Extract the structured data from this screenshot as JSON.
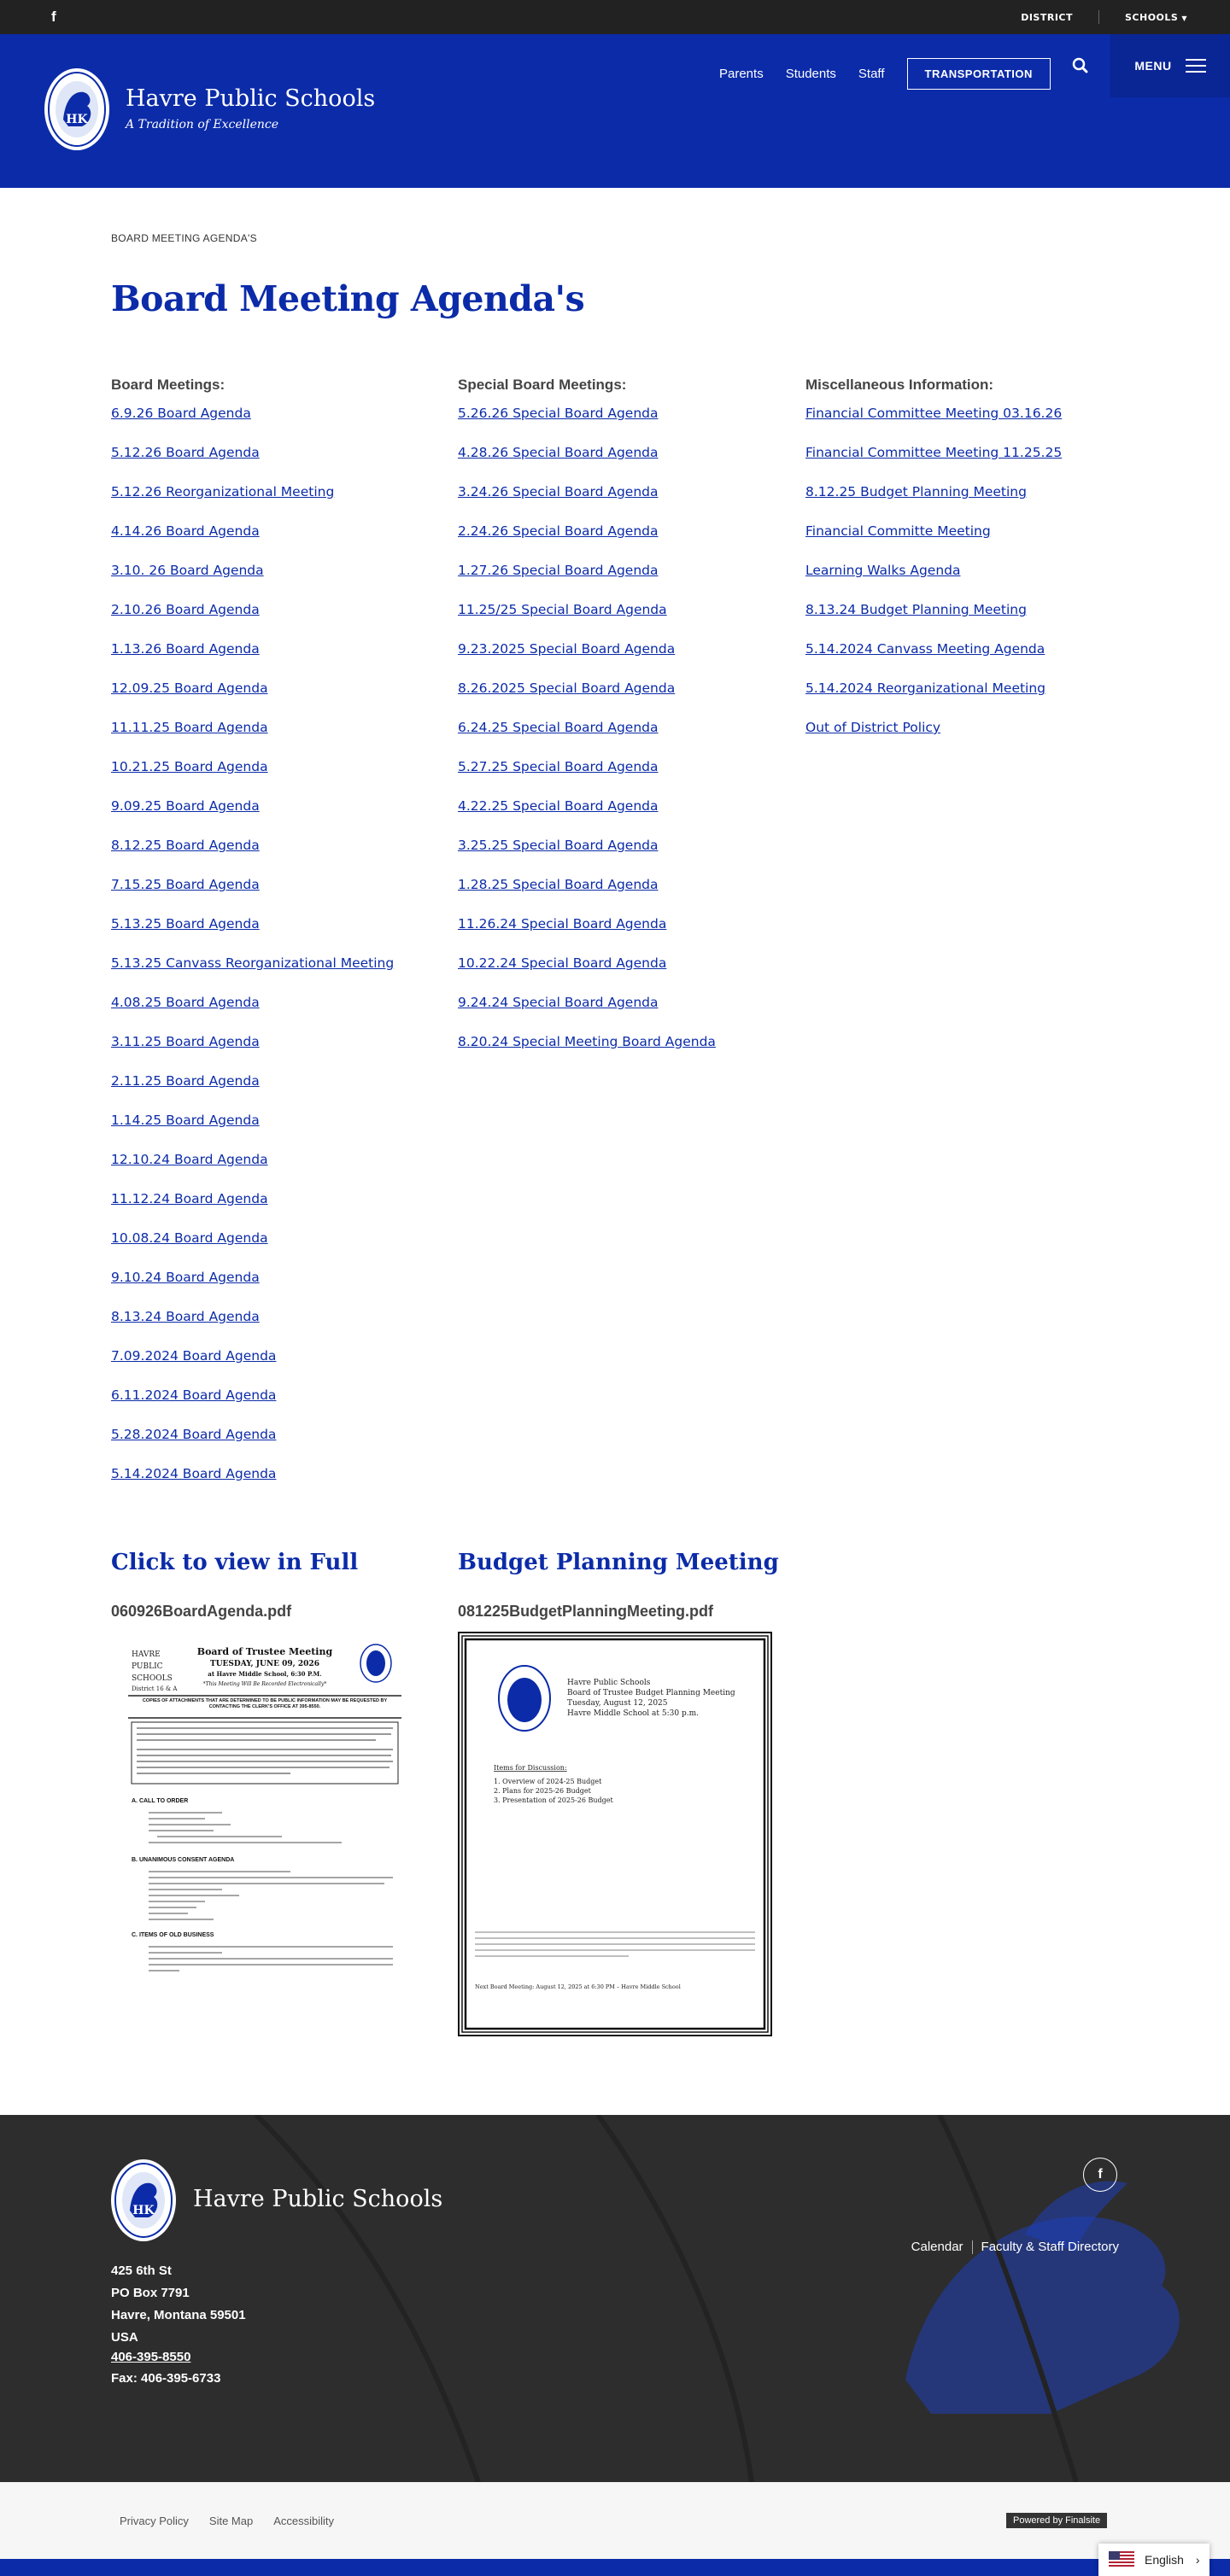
{
  "utility": {
    "facebook_glyph": "f",
    "district": "DISTRICT",
    "schools": "SCHOOLS"
  },
  "header": {
    "site_name": "Havre Public Schools",
    "tagline": "A Tradition of Excellence",
    "nav": [
      "Parents",
      "Students",
      "Staff"
    ],
    "transportation": "TRANSPORTATION",
    "menu": "MENU",
    "brand_color": "#0b2ba8"
  },
  "breadcrumb": "BOARD MEETING AGENDA'S",
  "page_title": "Board Meeting Agenda's",
  "columns": [
    {
      "heading": "Board Meetings:",
      "links": [
        "6.9.26 Board Agenda",
        "5.12.26 Board Agenda",
        "5.12.26 Reorganizational Meeting",
        "4.14.26 Board Agenda",
        "3.10. 26 Board Agenda",
        "2.10.26 Board Agenda",
        "1.13.26 Board Agenda",
        "12.09.25 Board Agenda",
        "11.11.25 Board Agenda",
        "10.21.25 Board Agenda",
        "9.09.25 Board Agenda",
        "8.12.25 Board Agenda",
        "7.15.25 Board Agenda",
        "5.13.25 Board Agenda",
        "5.13.25 Canvass Reorganizational Meeting",
        "4.08.25 Board Agenda",
        "3.11.25 Board Agenda",
        "2.11.25 Board Agenda",
        "1.14.25 Board Agenda",
        "12.10.24 Board Agenda",
        "11.12.24 Board Agenda",
        "10.08.24 Board Agenda",
        "9.10.24 Board Agenda",
        "8.13.24 Board Agenda",
        "7.09.2024 Board Agenda",
        "6.11.2024 Board Agenda",
        "5.28.2024 Board Agenda",
        "5.14.2024 Board Agenda"
      ]
    },
    {
      "heading": "Special Board Meetings:",
      "links": [
        "5.26.26 Special Board Agenda",
        "4.28.26 Special Board Agenda",
        "3.24.26 Special Board Agenda",
        "2.24.26 Special Board Agenda",
        "1.27.26 Special Board Agenda",
        "11.25/25 Special Board Agenda",
        "9.23.2025 Special Board Agenda",
        "8.26.2025 Special Board Agenda",
        "6.24.25 Special Board Agenda",
        "5.27.25 Special Board Agenda",
        "4.22.25 Special Board Agenda",
        "3.25.25 Special Board Agenda",
        "1.28.25 Special Board Agenda",
        "11.26.24 Special Board Agenda",
        "10.22.24 Special Board Agenda",
        "9.24.24 Special Board Agenda",
        "8.20.24 Special Meeting Board Agenda"
      ]
    },
    {
      "heading": "Miscellaneous Information:",
      "links": [
        "Financial Committee Meeting  03.16.26",
        "Financial Committee Meeting 11.25.25",
        "8.12.25 Budget Planning Meeting",
        "Financial Committe Meeting",
        "Learning Walks Agenda",
        "8.13.24 Budget Planning Meeting",
        "5.14.2024 Canvass Meeting Agenda",
        "5.14.2024 Reorganizational Meeting",
        "Out of District Policy"
      ]
    }
  ],
  "documents": [
    {
      "heading": "Click to view in Full",
      "file": "060926BoardAgenda.pdf",
      "thumb": {
        "org": [
          "HAVRE",
          "PUBLIC",
          "SCHOOLS",
          "District 16 & A"
        ],
        "title": "Board of Trustee Meeting",
        "date": "TUESDAY, JUNE 09, 2026",
        "place": "at Havre Middle School, 6:30 P.M.",
        "note": "*This Meeting Will Be Recorded Electronically*",
        "banner": "COPIES OF ATTACHMENTS THAT ARE DETERMINED TO BE PUBLIC INFORMATION MAY BE REQUESTED BY CONTACTING THE CLERK'S OFFICE AT 395-8550.",
        "sections": [
          "A.   CALL TO ORDER",
          "B.   UNANIMOUS CONSENT AGENDA",
          "C.   ITEMS OF OLD BUSINESS"
        ]
      }
    },
    {
      "heading": "Budget Planning Meeting",
      "file": "081225BudgetPlanningMeeting.pdf",
      "thumb": {
        "lines": [
          "Havre Public Schools",
          "Board of Trustee Budget Planning Meeting",
          "Tuesday, August 12, 2025",
          "Havre Middle School at 5:30 p.m."
        ],
        "items_title": "Items for Discussion:",
        "items": [
          "1.   Overview of 2024-25 Budget",
          "2.   Plans for 2025-26 Budget",
          "3.   Presentation of 2025-26 Budget"
        ],
        "next": "Next Board Meeting:  August 12, 2025 at 6:30 PM – Havre Middle School"
      }
    }
  ],
  "footer": {
    "name": "Havre Public Schools",
    "address": [
      "425 6th St",
      "PO Box 7791",
      "Havre, Montana  59501",
      "USA"
    ],
    "phone": "406-395-8550",
    "fax": "Fax: 406-395-6733",
    "links": [
      "Calendar",
      "Faculty & Staff Directory"
    ],
    "facebook_glyph": "f"
  },
  "subfooter": {
    "links": [
      "Privacy Policy",
      "Site Map",
      "Accessibility"
    ],
    "powered": "Powered by Finalsite"
  },
  "language": "English"
}
